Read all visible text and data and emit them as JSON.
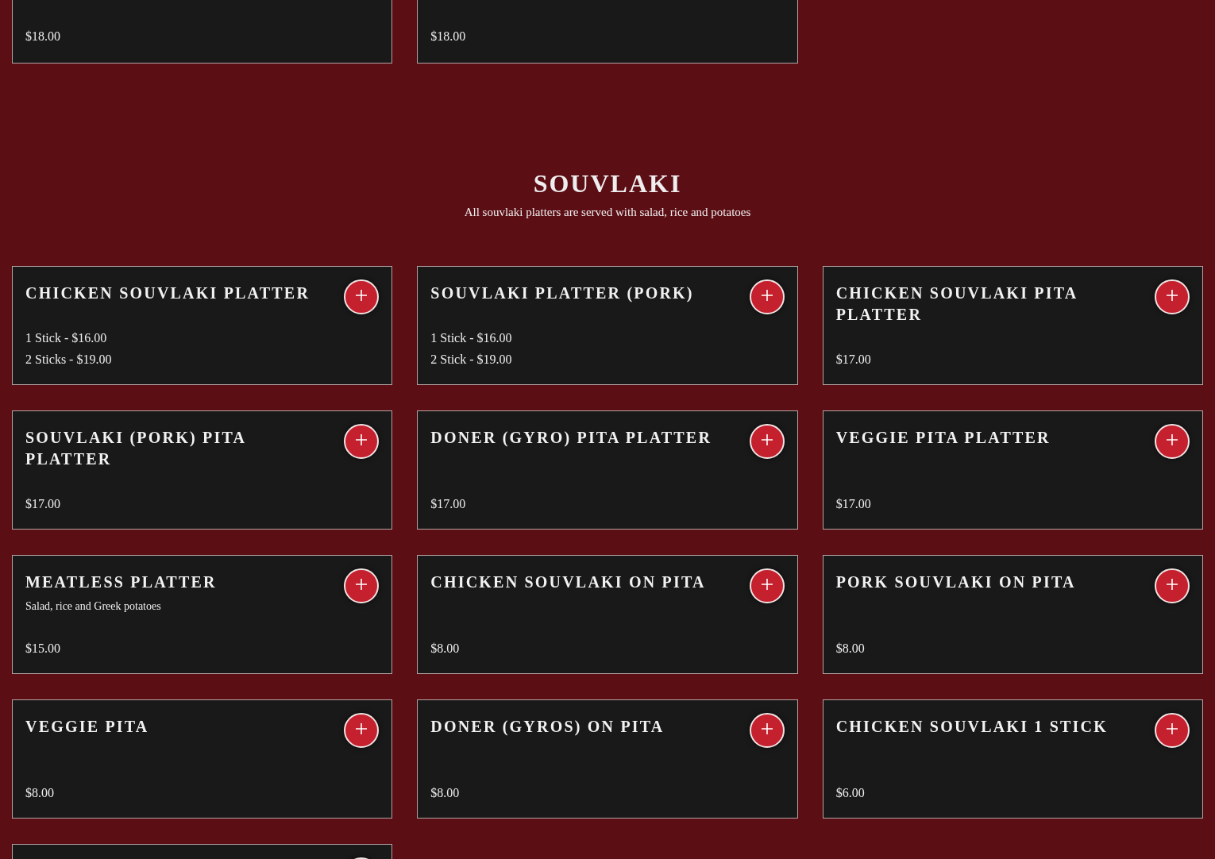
{
  "previous_section": {
    "items": [
      {
        "kind": "full",
        "prices": [
          "$18.00"
        ]
      },
      {
        "kind": "full",
        "prices": [
          "$18.00"
        ]
      }
    ]
  },
  "section": {
    "title": "SOUVLAKI",
    "subtitle": "All souvlaki platters are served with salad, rice and potatoes",
    "items": [
      {
        "kind": "full",
        "name": "CHICKEN SOUVLAKI PLATTER",
        "prices": [
          "1 Stick - $16.00",
          "2 Sticks - $19.00"
        ]
      },
      {
        "kind": "full",
        "name": "SOUVLAKI PLATTER (PORK)",
        "prices": [
          "1 Stick - $16.00",
          "2 Stick - $19.00"
        ]
      },
      {
        "kind": "full",
        "name": "CHICKEN SOUVLAKI PITA PLATTER",
        "prices": [
          "$17.00"
        ]
      },
      {
        "kind": "full",
        "name": "SOUVLAKI (PORK) PITA PLATTER",
        "prices": [
          "$17.00"
        ]
      },
      {
        "kind": "full",
        "name": "DONER (GYRO) PITA PLATTER",
        "prices": [
          "$17.00"
        ]
      },
      {
        "kind": "full",
        "name": "VEGGIE PITA PLATTER",
        "prices": [
          "$17.00"
        ]
      },
      {
        "kind": "full",
        "name": "MEATLESS PLATTER",
        "description": "Salad, rice and Greek potatoes",
        "prices": [
          "$15.00"
        ]
      },
      {
        "kind": "full",
        "name": "CHICKEN SOUVLAKI ON PITA",
        "prices": [
          "$8.00"
        ]
      },
      {
        "kind": "full",
        "name": "PORK SOUVLAKI ON PITA",
        "prices": [
          "$8.00"
        ]
      },
      {
        "kind": "full",
        "name": "VEGGIE PITA",
        "prices": [
          "$8.00"
        ]
      },
      {
        "kind": "full",
        "name": "DONER (GYROS) ON PITA",
        "prices": [
          "$8.00"
        ]
      },
      {
        "kind": "full",
        "name": "CHICKEN SOUVLAKI 1 STICK",
        "prices": [
          "$6.00"
        ]
      },
      {
        "kind": "partial"
      }
    ]
  }
}
